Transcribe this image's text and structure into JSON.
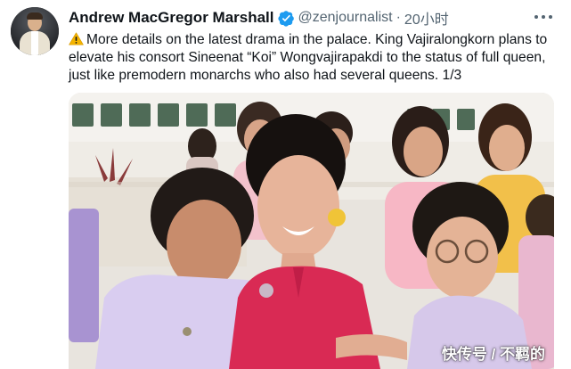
{
  "tweet": {
    "author_name": "Andrew MacGregor Marshall",
    "handle": "@zenjournalist",
    "separator": "·",
    "time": "20小时",
    "text": "More details on the latest drama in the palace. King Vajiralongkorn plans to elevate his consort Sineenat “Koi” Wongvajirapakdi to the status of full queen, just like premodern monarchs who also had several queens. 1/3",
    "icons": {
      "verified": "verified-badge-icon",
      "warning": "warning-icon",
      "more": "more-options-icon"
    }
  },
  "watermark": "快传号 / 不羁的",
  "colors": {
    "text": "#0f1419",
    "secondary": "#536471",
    "verified": "#1d9bf0",
    "warning": "#f4b400"
  }
}
